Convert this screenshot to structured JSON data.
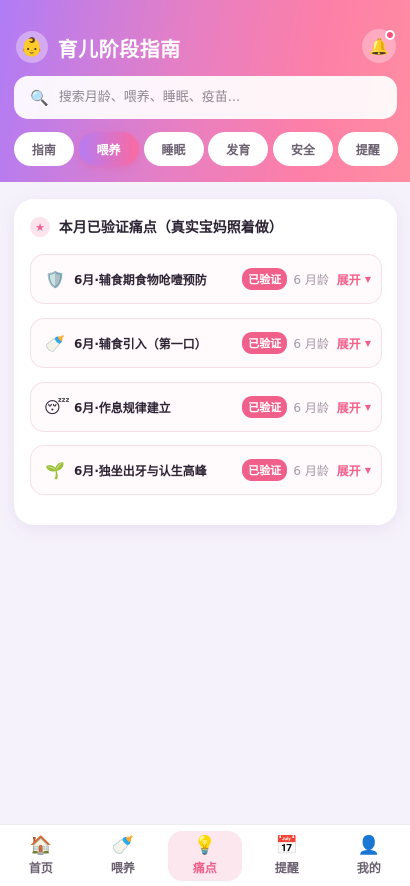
{
  "header": {
    "logo_icon": "baby-face-icon",
    "title": "育儿阶段指南",
    "bell_icon": "bell-icon"
  },
  "search": {
    "placeholder": "搜索月龄、喂养、睡眠、疫苗..."
  },
  "tabs": [
    {
      "label": "指南",
      "active": false
    },
    {
      "label": "喂养",
      "active": true
    },
    {
      "label": "睡眠",
      "active": false
    },
    {
      "label": "发育",
      "active": false
    },
    {
      "label": "安全",
      "active": false
    },
    {
      "label": "提醒",
      "active": false
    }
  ],
  "card": {
    "title": "本月已验证痛点（真实宝妈照着做）",
    "items": [
      {
        "icon": "shield-icon",
        "label": "6月·辅食期食物呛噎预防",
        "badge": "已验证",
        "age": "6 月龄",
        "action": "展开"
      },
      {
        "icon": "baby-bottle-icon",
        "label": "6月·辅食引入（第一口）",
        "badge": "已验证",
        "age": "6 月龄",
        "action": "展开"
      },
      {
        "icon": "sleeping-face-icon",
        "label": "6月·作息规律建立",
        "badge": "已验证",
        "age": "6 月龄",
        "action": "展开"
      },
      {
        "icon": "seedling-icon",
        "label": "6月·独坐出牙与认生高峰",
        "badge": "已验证",
        "age": "6 月龄",
        "action": "展开"
      }
    ]
  },
  "bottom_nav": [
    {
      "icon": "home-icon",
      "label": "首页",
      "active": false
    },
    {
      "icon": "baby-bottle-icon",
      "label": "喂养",
      "active": false
    },
    {
      "icon": "lightbulb-icon",
      "label": "痛点",
      "active": true
    },
    {
      "icon": "calendar-icon",
      "label": "提醒",
      "active": false
    },
    {
      "icon": "user-icon",
      "label": "我的",
      "active": false
    }
  ],
  "colors": {
    "accent": "#f0608a",
    "gradient_start": "#b07cf6",
    "gradient_end": "#ff8ea2"
  }
}
